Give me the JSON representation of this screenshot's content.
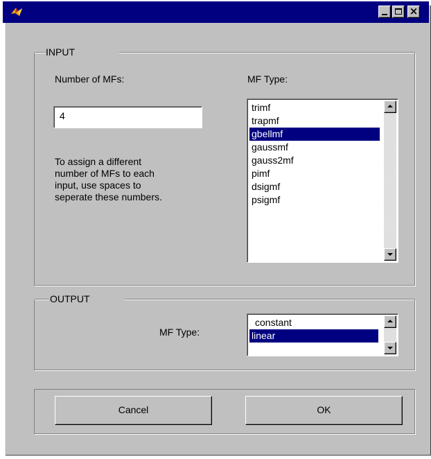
{
  "window": {
    "title": "",
    "controls": {
      "minimize": "minimize",
      "maximize": "maximize",
      "close": "×"
    }
  },
  "input": {
    "group_label": "INPUT",
    "num_mfs_label": "Number of MFs:",
    "num_mfs_value": "4",
    "help_lines": [
      "To assign a different",
      "number of MFs to each",
      "input, use spaces to",
      "seperate these numbers."
    ],
    "mf_type_label": "MF Type:",
    "mf_types": [
      "trimf",
      "trapmf",
      "gbellmf",
      "gaussmf",
      "gauss2mf",
      "pimf",
      "dsigmf",
      "psigmf"
    ],
    "selected_index": 2
  },
  "output": {
    "group_label": "OUTPUT",
    "mf_type_label": "MF Type:",
    "mf_types": [
      "constant",
      "linear"
    ],
    "selected_index": 1
  },
  "buttons": {
    "cancel": "Cancel",
    "ok": "OK"
  },
  "colors": {
    "titlebar": "#000080",
    "face": "#c0c0c0",
    "selection": "#000080"
  }
}
